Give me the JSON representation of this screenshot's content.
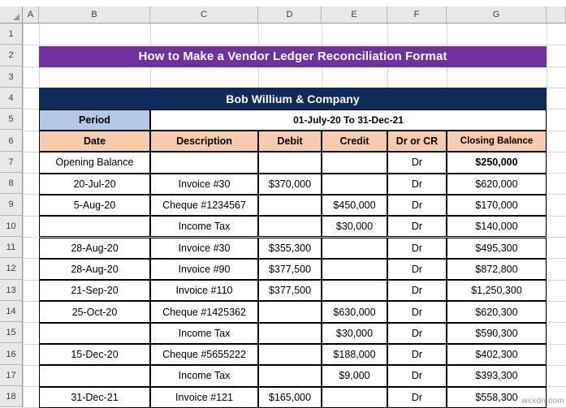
{
  "spreadsheet": {
    "column_headers": [
      "A",
      "B",
      "C",
      "D",
      "E",
      "F",
      "G"
    ],
    "row_headers": [
      "1",
      "2",
      "3",
      "4",
      "5",
      "6",
      "7",
      "8",
      "9",
      "10",
      "11",
      "12",
      "13",
      "14",
      "15",
      "16",
      "17",
      "18"
    ],
    "corner_select_all": "select-all"
  },
  "colors": {
    "title_banner_bg": "#7030A0",
    "company_banner_bg": "#0E2B5C",
    "period_label_bg": "#B4C7E7",
    "table_header_bg": "#F8CBAD",
    "cell_bg": "#FFFFFF",
    "grid_line": "#D8D8D8",
    "cell_border": "#000000",
    "gutter_bg": "#E8E8E8",
    "banner_text": "#FFFFFF"
  },
  "report": {
    "title": "How to Make a Vendor Ledger Reconciliation Format",
    "company": "Bob Willium & Company",
    "period_label": "Period",
    "period_value": "01-July-20 To 31-Dec-21",
    "columns": [
      "Date",
      "Description",
      "Debit",
      "Credit",
      "Dr or CR",
      "Closing Balance"
    ],
    "rows": [
      {
        "date": "Opening Balance",
        "description": "",
        "debit": "",
        "credit": "",
        "drcr": "Dr",
        "closing": "$250,000",
        "closing_bold": true,
        "date_bold": false
      },
      {
        "date": "20-Jul-20",
        "description": "Invoice #30",
        "debit": "$370,000",
        "credit": "",
        "drcr": "Dr",
        "closing": "$620,000",
        "closing_bold": false,
        "date_bold": false
      },
      {
        "date": "5-Aug-20",
        "description": "Cheque #1234567",
        "debit": "",
        "credit": "$450,000",
        "drcr": "Dr",
        "closing": "$170,000",
        "closing_bold": false,
        "date_bold": false
      },
      {
        "date": "",
        "description": "Income Tax",
        "debit": "",
        "credit": "$30,000",
        "drcr": "Dr",
        "closing": "$140,000",
        "closing_bold": false,
        "date_bold": false
      },
      {
        "date": "28-Aug-20",
        "description": "Invoice #30",
        "debit": "$355,300",
        "credit": "",
        "drcr": "Dr",
        "closing": "$495,300",
        "closing_bold": false,
        "date_bold": false
      },
      {
        "date": "28-Aug-20",
        "description": "Invoice #90",
        "debit": "$377,500",
        "credit": "",
        "drcr": "Dr",
        "closing": "$872,800",
        "closing_bold": false,
        "date_bold": false
      },
      {
        "date": "21-Sep-20",
        "description": "Invoice #110",
        "debit": "$377,500",
        "credit": "",
        "drcr": "Dr",
        "closing": "$1,250,300",
        "closing_bold": false,
        "date_bold": false
      },
      {
        "date": "25-Oct-20",
        "description": "Cheque #1425362",
        "debit": "",
        "credit": "$630,000",
        "drcr": "Dr",
        "closing": "$620,300",
        "closing_bold": false,
        "date_bold": false
      },
      {
        "date": "",
        "description": "Income Tax",
        "debit": "",
        "credit": "$30,000",
        "drcr": "Dr",
        "closing": "$590,300",
        "closing_bold": false,
        "date_bold": false
      },
      {
        "date": "15-Dec-20",
        "description": "Cheque #5655222",
        "debit": "",
        "credit": "$188,000",
        "drcr": "Dr",
        "closing": "$402,300",
        "closing_bold": false,
        "date_bold": false
      },
      {
        "date": "",
        "description": "Income Tax",
        "debit": "",
        "credit": "$9,000",
        "drcr": "Dr",
        "closing": "$393,300",
        "closing_bold": false,
        "date_bold": false
      },
      {
        "date": "31-Dec-21",
        "description": "Invoice #121",
        "debit": "$165,000",
        "credit": "",
        "drcr": "Dr",
        "closing": "$558,300",
        "closing_bold": false,
        "date_bold": false
      }
    ]
  },
  "watermark": "wsxdn.com"
}
